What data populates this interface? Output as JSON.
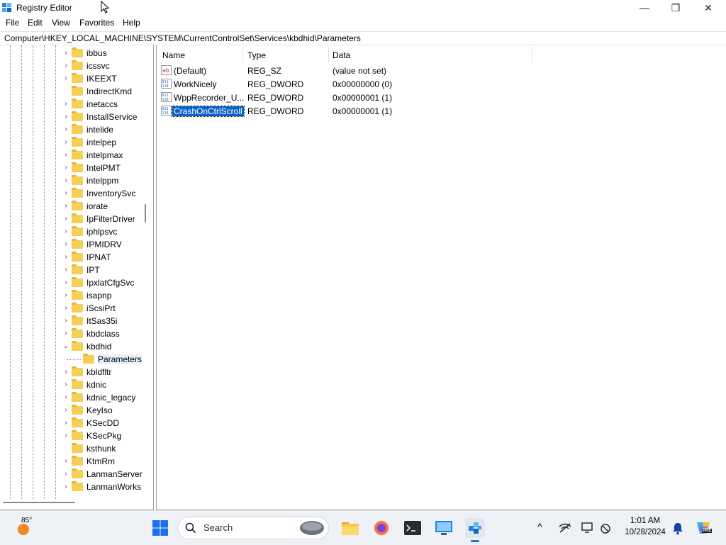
{
  "window": {
    "title": "Registry Editor",
    "controls": {
      "minimize": "—",
      "maximize": "❐",
      "close": "✕"
    }
  },
  "menu": [
    "File",
    "Edit",
    "View",
    "Favorites",
    "Help"
  ],
  "address": "Computer\\HKEY_LOCAL_MACHINE\\SYSTEM\\CurrentControlSet\\Services\\kbdhid\\Parameters",
  "tree": {
    "nodes": [
      {
        "label": "ibbus",
        "expander": ">"
      },
      {
        "label": "icssvc",
        "expander": ">"
      },
      {
        "label": "IKEEXT",
        "expander": ">"
      },
      {
        "label": "IndirectKmd",
        "expander": ""
      },
      {
        "label": "inetaccs",
        "expander": ">"
      },
      {
        "label": "InstallService",
        "expander": ">"
      },
      {
        "label": "intelide",
        "expander": ">"
      },
      {
        "label": "intelpep",
        "expander": ">"
      },
      {
        "label": "intelpmax",
        "expander": ">"
      },
      {
        "label": "IntelPMT",
        "expander": ">"
      },
      {
        "label": "intelppm",
        "expander": ">"
      },
      {
        "label": "InventorySvc",
        "expander": ">"
      },
      {
        "label": "iorate",
        "expander": ">"
      },
      {
        "label": "IpFilterDriver",
        "expander": ">"
      },
      {
        "label": "iphlpsvc",
        "expander": ">"
      },
      {
        "label": "IPMIDRV",
        "expander": ">"
      },
      {
        "label": "IPNAT",
        "expander": ">"
      },
      {
        "label": "IPT",
        "expander": ">"
      },
      {
        "label": "IpxlatCfgSvc",
        "expander": ">"
      },
      {
        "label": "isapnp",
        "expander": ">"
      },
      {
        "label": "iScsiPrt",
        "expander": ">"
      },
      {
        "label": "ItSas35i",
        "expander": ">"
      },
      {
        "label": "kbdclass",
        "expander": ">"
      },
      {
        "label": "kbdhid",
        "expander": "v"
      },
      {
        "label": "Parameters",
        "expander": "",
        "child": true
      },
      {
        "label": "kbldfltr",
        "expander": ">"
      },
      {
        "label": "kdnic",
        "expander": ">"
      },
      {
        "label": "kdnic_legacy",
        "expander": ">"
      },
      {
        "label": "KeyIso",
        "expander": ">"
      },
      {
        "label": "KSecDD",
        "expander": ">"
      },
      {
        "label": "KSecPkg",
        "expander": ">"
      },
      {
        "label": "ksthunk",
        "expander": ""
      },
      {
        "label": "KtmRm",
        "expander": ">"
      },
      {
        "label": "LanmanServer",
        "expander": ">"
      },
      {
        "label": "LanmanWorks",
        "expander": ">"
      }
    ]
  },
  "list": {
    "headers": {
      "name": "Name",
      "type": "Type",
      "data": "Data"
    },
    "rows": [
      {
        "icon": "string-value-icon",
        "name": "(Default)",
        "type": "REG_SZ",
        "data": "(value not set)"
      },
      {
        "icon": "dword-value-icon",
        "name": "WorkNicely",
        "type": "REG_DWORD",
        "data": "0x00000000 (0)"
      },
      {
        "icon": "dword-value-icon",
        "name": "WppRecorder_U...",
        "type": "REG_DWORD",
        "data": "0x00000001 (1)"
      },
      {
        "icon": "dword-value-icon",
        "name": "CrashOnCtrlScroll",
        "type": "REG_DWORD",
        "data": "0x00000001 (1)",
        "selected": true
      }
    ]
  },
  "taskbar": {
    "weather": "85°",
    "search_placeholder": "Search",
    "time": "1:01 AM",
    "date": "10/28/2024",
    "copilot_badge": "PRE"
  },
  "colors": {
    "selection": "#0a63c7",
    "folder": "#f6cf57",
    "taskbar": "#eef1f6"
  }
}
